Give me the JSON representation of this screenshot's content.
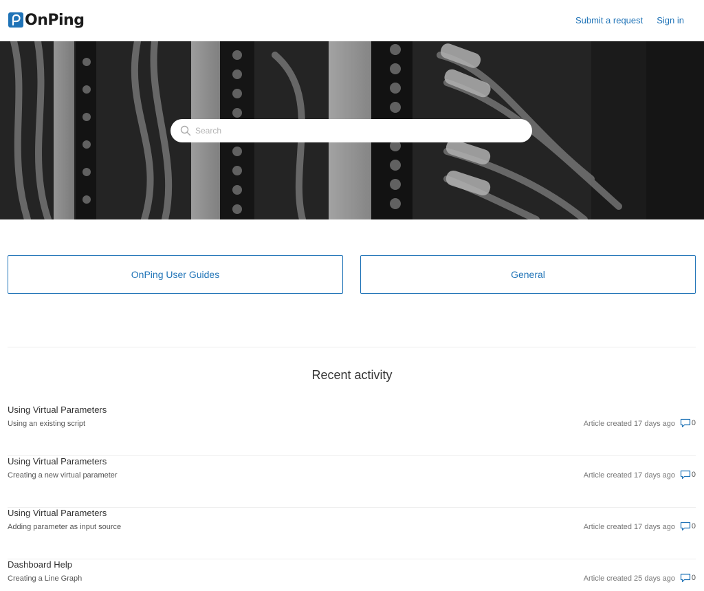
{
  "header": {
    "logo_text": "OnPing",
    "nav": {
      "submit_request": "Submit a request",
      "sign_in": "Sign in"
    }
  },
  "hero": {
    "search_placeholder": "Search"
  },
  "categories": [
    {
      "label": "OnPing User Guides"
    },
    {
      "label": "General"
    }
  ],
  "recent": {
    "title": "Recent activity",
    "items": [
      {
        "title": "Using Virtual Parameters",
        "subtitle": "Using an existing script",
        "meta": "Article created 17 days ago",
        "comments": "0"
      },
      {
        "title": "Using Virtual Parameters",
        "subtitle": "Creating a new virtual parameter",
        "meta": "Article created 17 days ago",
        "comments": "0"
      },
      {
        "title": "Using Virtual Parameters",
        "subtitle": "Adding parameter as input source",
        "meta": "Article created 17 days ago",
        "comments": "0"
      },
      {
        "title": "Dashboard Help",
        "subtitle": "Creating a Line Graph",
        "meta": "Article created 25 days ago",
        "comments": "0"
      }
    ]
  },
  "colors": {
    "accent": "#1f73b7",
    "hero_bg": "#2f2f2f"
  },
  "icons": [
    "logo-icon",
    "search-icon",
    "comment-icon"
  ]
}
